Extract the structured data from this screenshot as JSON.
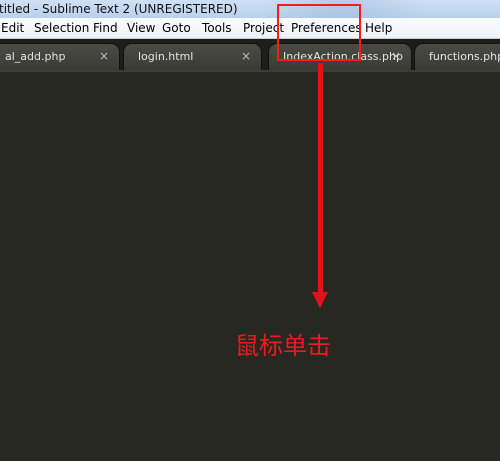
{
  "window": {
    "title": "titled - Sublime Text 2 (UNREGISTERED)"
  },
  "menu": {
    "items": [
      "Edit",
      "Selection",
      "Find",
      "View",
      "Goto",
      "Tools",
      "Project",
      "Preferences",
      "Help"
    ]
  },
  "tabs": [
    {
      "label": "al_add.php",
      "close": "×"
    },
    {
      "label": "login.html",
      "close": "×"
    },
    {
      "label": "IndexAction.class.php",
      "close": "×"
    },
    {
      "label": "functions.php",
      "close": "×"
    }
  ],
  "annotation": {
    "text": "鼠标单击",
    "color": "#e0141a"
  }
}
